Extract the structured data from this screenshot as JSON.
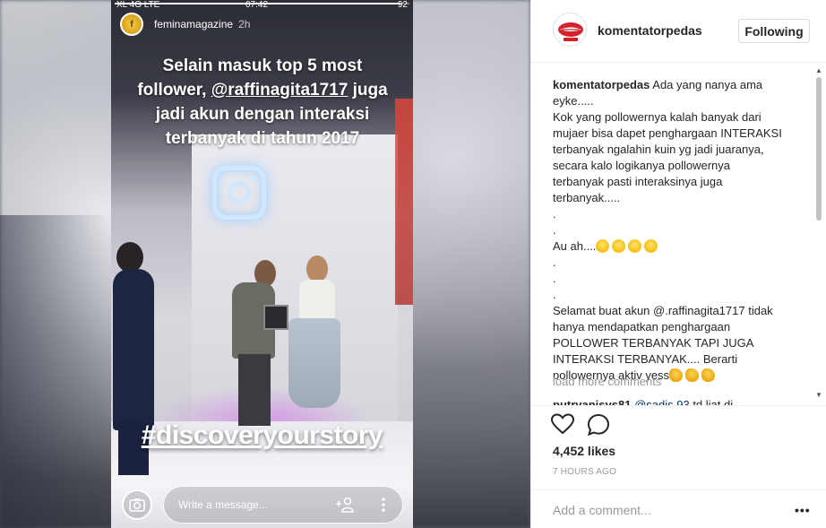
{
  "story": {
    "status_left": "XL 4G LTE",
    "status_time": "07:42",
    "status_right": "92",
    "progress": 0.97,
    "username": "feminamagazine",
    "age": "2h",
    "caption_line1": "Selain masuk top 5 most",
    "caption_line2_pre": "follower, ",
    "caption_mention": "@raffinagita1717",
    "caption_line2_post": " juga",
    "caption_line3": "jadi akun dengan interaksi",
    "caption_line4": "terbanyak di tahun 2017",
    "hashtag": "#discoveryourstory",
    "message_placeholder": "Write a message..."
  },
  "post": {
    "account_name": "komentatorpedas",
    "follow_label": "Following",
    "comment": {
      "user": "komentatorpedas",
      "lines": [
        "Ada yang nanya ama",
        "eyke.....",
        "Kok yang pollowernya kalah banyak dari",
        "mujaer bisa dapet penghargaan INTERAKSI",
        "terbanyak ngalahin kuin yg jadi juaranya,",
        "secara kalo logikanya pollowernya",
        "terbanyak pasti interaksinya juga",
        "terbanyak.....",
        ".",
        ".",
        "Au ah....",
        ".",
        ".",
        ".",
        "Selamat buat akun @.raffinagita1717 tidak",
        "hanya mendapatkan penghargaan",
        "POLLOWER TERBANYAK TAPI JUGA",
        "INTERAKSI TERBANYAK.... Berarti",
        "pollowernya aktiv yess"
      ]
    },
    "load_more": "load more comments",
    "next_comment_user": "putryanisys81",
    "next_comment_mention": "@sadis.93",
    "next_comment_text": "td liat di",
    "likes": "4,452 likes",
    "time_ago": "7 HOURS AGO",
    "add_comment_placeholder": "Add a comment...",
    "more_label": "•••"
  },
  "icons": {
    "heart": "heart-icon",
    "comment": "comment-icon",
    "camera": "camera-icon",
    "add_user": "add-user-icon",
    "more": "more-vertical-icon"
  }
}
